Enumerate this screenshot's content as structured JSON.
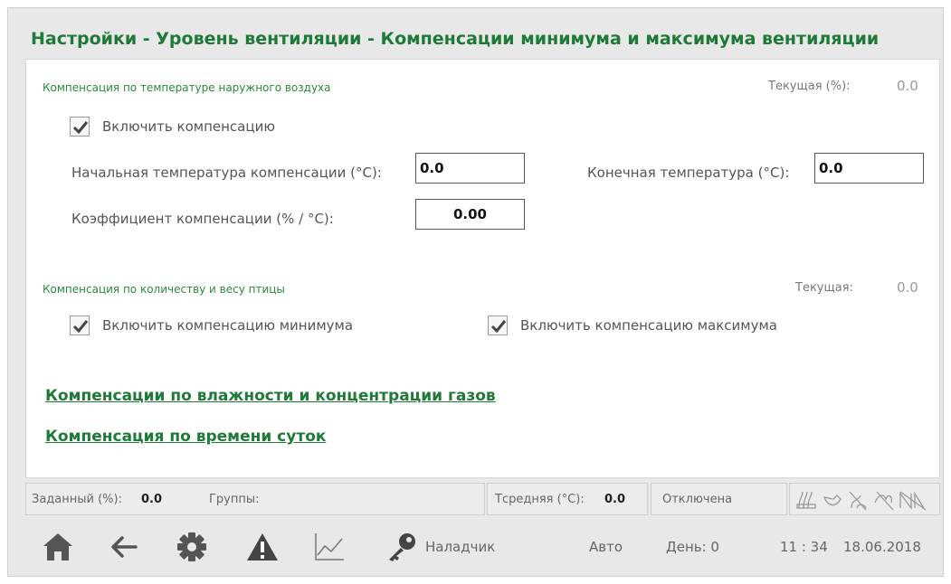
{
  "title": "Настройки - Уровень вентиляции - Компенсации минимума и максимума вентиляции",
  "outside_temp": {
    "title": "Компенсация по температуре наружного воздуха",
    "current_label": "Текущая (%):",
    "current_value": "0.0",
    "enable_label": "Включить компенсацию",
    "enabled": true,
    "start_temp_label": "Начальная температура компенсации (°C):",
    "start_temp_value": "0.0",
    "end_temp_label": "Конечная температура (°C):",
    "end_temp_value": "0.0",
    "coef_label": "Коэффициент компенсации (% / °C):",
    "coef_value": "0.00"
  },
  "birds": {
    "title": "Компенсация по количеству и весу птицы",
    "current_label": "Текущая:",
    "current_value": "0.0",
    "enable_min_label": "Включить компенсацию минимума",
    "enable_min": true,
    "enable_max_label": "Включить компенсацию максимума",
    "enable_max": true
  },
  "links": {
    "humidity_gas": "Компенсации по влажности и концентрации газов",
    "time_of_day": "Компенсация по времени суток"
  },
  "status": {
    "setpoint_label": "Заданный (%):",
    "setpoint_value": "0.0",
    "groups_label": "Группы:",
    "avg_temp_label": "Тсредняя (°C):",
    "avg_temp_value": "0.0",
    "state": "Отключена",
    "icons": [
      "heater-icon",
      "bird-icon",
      "no-fan-icon",
      "cooling-icon",
      "no-light-icon"
    ]
  },
  "nav": {
    "user": "Наладчик",
    "mode": "Авто",
    "day_label": "День: 0",
    "time": "11 : 34",
    "date": "18.06.2018",
    "icons": [
      "home-icon",
      "back-arrow-icon",
      "gear-icon",
      "alarm-icon",
      "graph-icon",
      "key-icon"
    ]
  },
  "colors": {
    "accent": "#1e7a36",
    "section": "#2b8a3e",
    "background": "#e8e8e8"
  }
}
